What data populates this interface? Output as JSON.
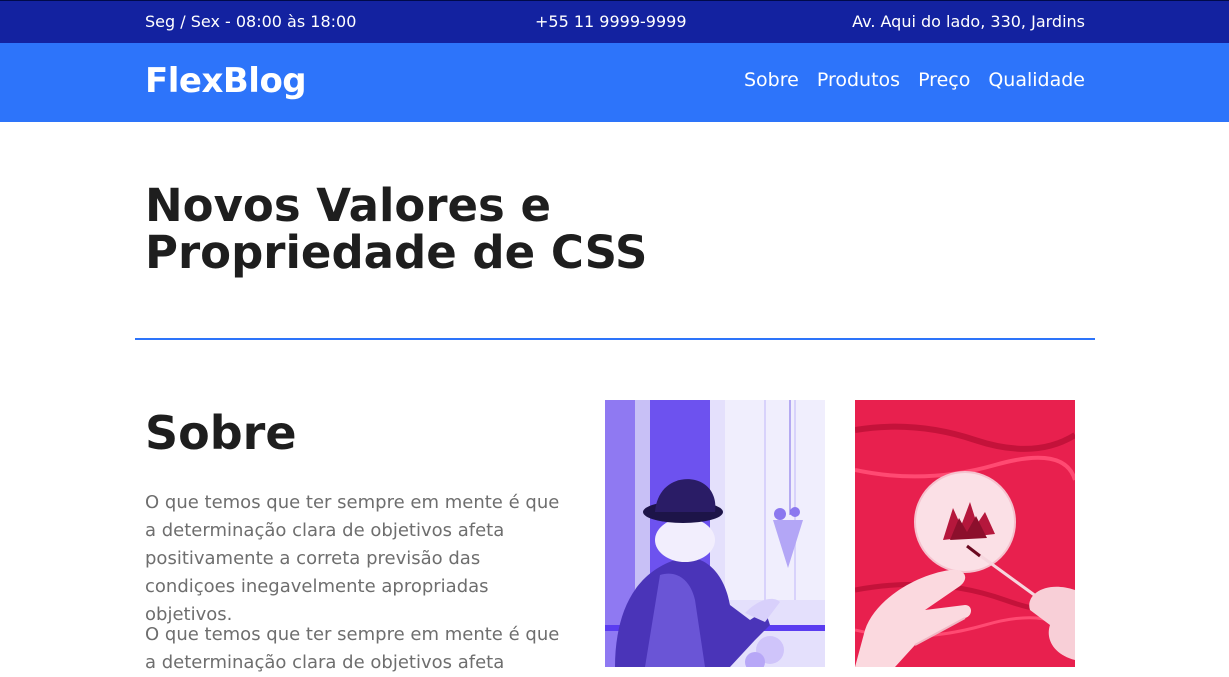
{
  "topbar": {
    "hours": "Seg / Sex - 08:00 às 18:00",
    "phone": "+55 11 9999-9999",
    "address": "Av. Aqui do lado, 330, Jardins"
  },
  "header": {
    "logo": "FlexBlog",
    "nav": [
      "Sobre",
      "Produtos",
      "Preço",
      "Qualidade"
    ]
  },
  "hero": {
    "title": "Novos Valores e Propriedade de CSS"
  },
  "about": {
    "title": "Sobre",
    "paragraphs": [
      "O que temos que ter sempre em mente é que a determinação clara de objetivos afeta positivamente a correta previsão das condiçoes inegavelmente apropriadas objetivos.",
      "O que temos que ter sempre em mente é que a determinação clara de objetivos afeta"
    ],
    "images": [
      "woman-in-hat-photo",
      "painting-hands-photo"
    ]
  },
  "colors": {
    "topbar": "#1322a0",
    "header": "#2d74fa",
    "accent": "#2d74fa",
    "purple_photo": "#5a3cf0",
    "red_photo": "#e8204e"
  }
}
